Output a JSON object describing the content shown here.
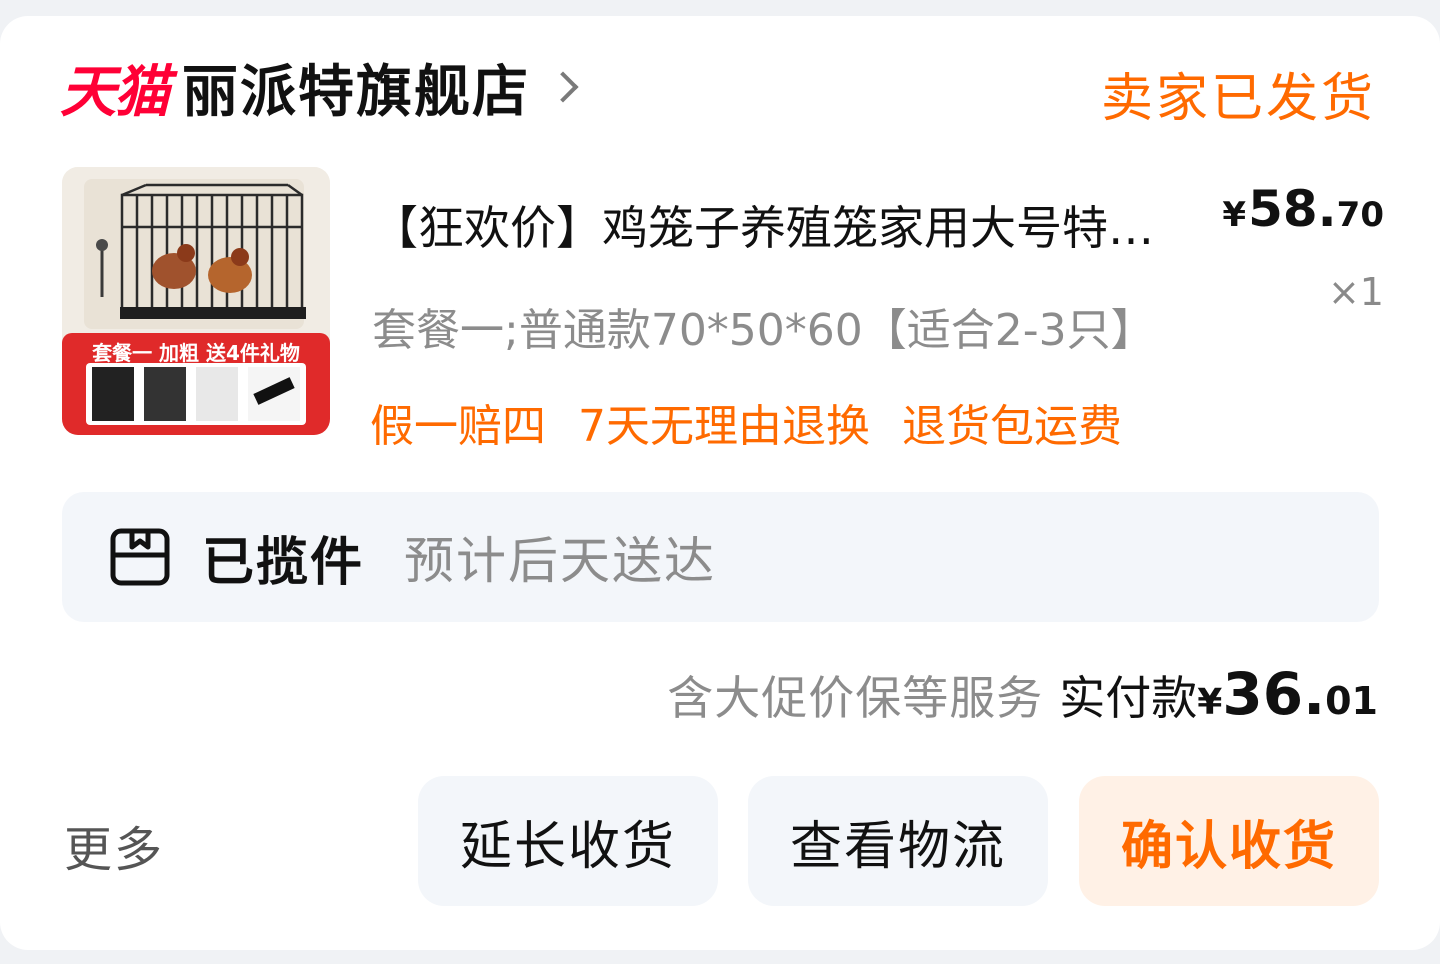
{
  "store": {
    "platform_logo": "天猫",
    "name": "丽派特旗舰店",
    "status": "卖家已发货"
  },
  "product": {
    "title": "【狂欢价】鸡笼子养殖笼家用大号特…",
    "price_currency": "¥",
    "price_int": "58.",
    "price_dec": "70",
    "quantity": "×1",
    "sku": "套餐一;普通款70*50*60【适合2-3只】",
    "thumb_banner": "套餐一 加粗 送4件礼物",
    "services": [
      "假一赔四",
      "7天无理由退换",
      "退货包运费"
    ]
  },
  "logistics": {
    "icon": "package-icon",
    "status": "已揽件",
    "eta": "预计后天送达"
  },
  "payment": {
    "note": "含大促价保等服务",
    "label": "实付款",
    "currency": "¥",
    "amount_int": "36.",
    "amount_dec": "01"
  },
  "actions": {
    "more": "更多",
    "extend": "延长收货",
    "track": "查看物流",
    "confirm": "确认收货"
  },
  "colors": {
    "accent": "#ff6a00",
    "tmall_red": "#ff0036",
    "muted": "#8c8c8c",
    "panel": "#f3f6fa",
    "confirm_bg": "#fff1e6"
  }
}
